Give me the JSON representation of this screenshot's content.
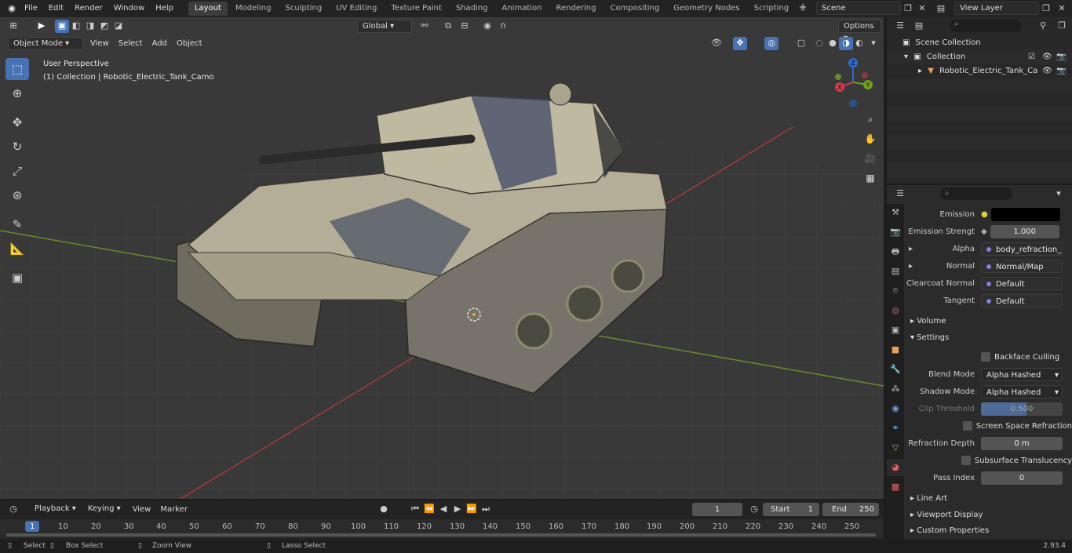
{
  "menu": [
    "File",
    "Edit",
    "Render",
    "Window",
    "Help"
  ],
  "workspaces": [
    "Layout",
    "Modeling",
    "Sculpting",
    "UV Editing",
    "Texture Paint",
    "Shading",
    "Animation",
    "Rendering",
    "Compositing",
    "Geometry Nodes",
    "Scripting"
  ],
  "active_workspace": "Layout",
  "scene_name": "Scene",
  "view_layer": "View Layer",
  "viewport": {
    "mode": "Object Mode",
    "menus": [
      "View",
      "Select",
      "Add",
      "Object"
    ],
    "transform": "Global",
    "options": "Options",
    "info_line1": "User Perspective",
    "info_line2": "(1) Collection | Robotic_Electric_Tank_Camo",
    "gizmo": {
      "x": "X",
      "y": "Y",
      "z": "Z"
    }
  },
  "outliner": {
    "scene_collection": "Scene Collection",
    "collection": "Collection",
    "object": "Robotic_Electric_Tank_Ca"
  },
  "properties": {
    "emission_label": "Emission",
    "emission_color": "#000000",
    "emission_strength_label": "Emission Strengt",
    "emission_strength": "1.000",
    "alpha_label": "Alpha",
    "alpha_value": "body_refraction_inv...",
    "normal_label": "Normal",
    "normal_value": "Normal/Map",
    "clearcoat_label": "Clearcoat Normal",
    "clearcoat_value": "Default",
    "tangent_label": "Tangent",
    "tangent_value": "Default",
    "volume": "Volume",
    "settings": "Settings",
    "backface": "Backface Culling",
    "blend_label": "Blend Mode",
    "blend_value": "Alpha Hashed",
    "shadow_label": "Shadow Mode",
    "shadow_value": "Alpha Hashed",
    "clip_label": "Clip Threshold",
    "clip_value": "0.500",
    "ssr": "Screen Space Refraction",
    "refr_label": "Refraction Depth",
    "refr_value": "0 m",
    "sst": "Subsurface Translucency",
    "pass_label": "Pass Index",
    "pass_value": "0",
    "line_art": "Line Art",
    "viewport_display": "Viewport Display",
    "custom_props": "Custom Properties"
  },
  "timeline": {
    "menus": [
      "Playback",
      "Keying",
      "View",
      "Marker"
    ],
    "current_frame": "1",
    "start_label": "Start",
    "start": "1",
    "end_label": "End",
    "end": "250",
    "ticks": [
      "1",
      "10",
      "20",
      "30",
      "40",
      "50",
      "60",
      "70",
      "80",
      "90",
      "100",
      "110",
      "120",
      "130",
      "140",
      "150",
      "160",
      "170",
      "180",
      "190",
      "200",
      "210",
      "220",
      "230",
      "240",
      "250"
    ]
  },
  "status": {
    "select": "Select",
    "box_select": "Box Select",
    "zoom_view": "Zoom View",
    "lasso_select": "Lasso Select",
    "version": "2.93.4"
  }
}
